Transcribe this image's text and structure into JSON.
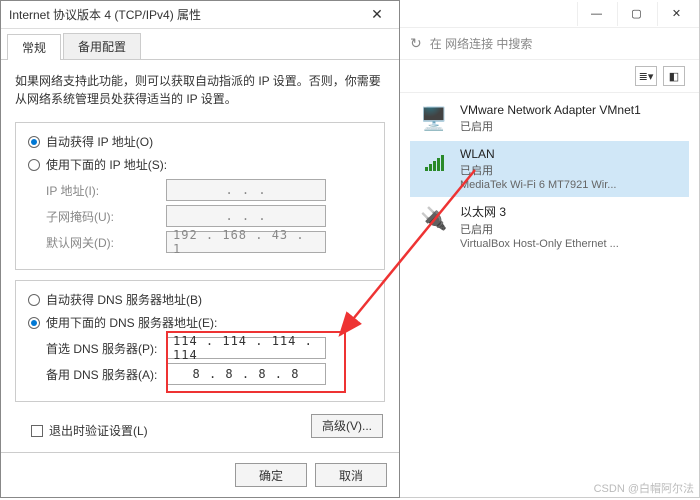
{
  "dialog": {
    "title": "Internet 协议版本 4 (TCP/IPv4) 属性",
    "tabs": {
      "general": "常规",
      "alternate": "备用配置"
    },
    "intro": "如果网络支持此功能，则可以获取自动指派的 IP 设置。否则，你需要从网络系统管理员处获得适当的 IP 设置。",
    "ip": {
      "auto": "自动获得 IP 地址(O)",
      "manual": "使用下面的 IP 地址(S):",
      "addr_label": "IP 地址(I):",
      "mask_label": "子网掩码(U):",
      "gw_label": "默认网关(D):",
      "addr": ".   .   .",
      "mask": ".   .   .",
      "gw": "192 . 168 .  43  .   1"
    },
    "dns": {
      "auto": "自动获得 DNS 服务器地址(B)",
      "manual": "使用下面的 DNS 服务器地址(E):",
      "pref_label": "首选 DNS 服务器(P):",
      "alt_label": "备用 DNS 服务器(A):",
      "pref": "114 . 114 . 114 . 114",
      "alt": "8  .   8   .   8   .   8"
    },
    "validate": "退出时验证设置(L)",
    "advanced": "高级(V)...",
    "ok": "确定",
    "cancel": "取消"
  },
  "bg": {
    "search_placeholder": "在 网络连接 中搜索",
    "adapters": [
      {
        "name": "VMware Network Adapter VMnet1",
        "status": "已启用",
        "desc": ""
      },
      {
        "name": "WLAN",
        "status": "已启用",
        "desc": "MediaTek Wi-Fi 6 MT7921 Wir..."
      },
      {
        "name": "以太网 3",
        "status": "已启用",
        "desc": "VirtualBox Host-Only Ethernet ..."
      }
    ]
  },
  "watermark": "CSDN @白帽阿尔法"
}
